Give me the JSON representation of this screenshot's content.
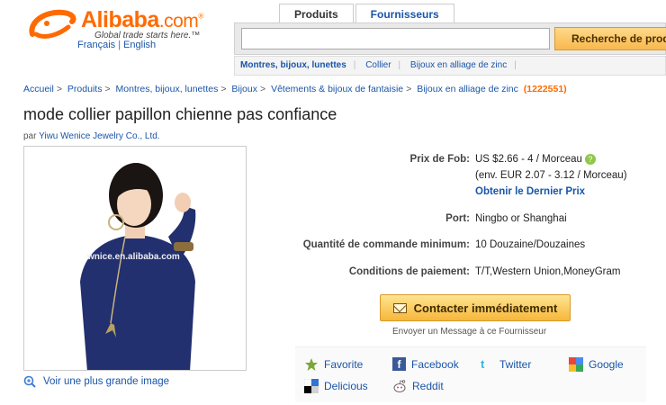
{
  "header": {
    "logo_name": "Alibaba",
    "logo_tld": ".com",
    "logo_reg": "®",
    "tagline": "Global trade starts here.™",
    "lang_fr": "Français",
    "lang_sep": "|",
    "lang_en": "English"
  },
  "search": {
    "tabs": [
      "Produits",
      "Fournisseurs"
    ],
    "active_tab": "Produits",
    "input_value": "",
    "button_label": "Recherche de prod",
    "categories": [
      "Montres, bijoux, lunettes",
      "Collier",
      "Bijoux en alliage de zinc"
    ]
  },
  "breadcrumb": {
    "items": [
      "Accueil",
      "Produits",
      "Montres, bijoux, lunettes",
      "Bijoux",
      "Vêtements & bijoux de fantaisie",
      "Bijoux en alliage de zinc"
    ],
    "separator": ">",
    "count": "(1222551)"
  },
  "product": {
    "title": "mode collier papillon chienne pas confiance",
    "seller_prefix": "par",
    "seller_name": "Yiwu Wenice Jewelry Co., Ltd.",
    "watermark": "wnice.en.alibaba.com",
    "enlarge_label": "Voir une plus grande image"
  },
  "specs": {
    "fob_label": "Prix de Fob:",
    "fob_value": "US $2.66 - 4 / Morceau",
    "fob_eur": "(env. EUR 2.07 - 3.12 / Morceau)",
    "fob_link": "Obtenir le Dernier Prix",
    "port_label": "Port:",
    "port_value": "Ningbo or Shanghai",
    "moq_label": "Quantité de commande minimum:",
    "moq_value": "10 Douzaine/Douzaines",
    "pay_label": "Conditions de paiement:",
    "pay_value": "T/T,Western Union,MoneyGram"
  },
  "contact": {
    "button_label": "Contacter immédiatement",
    "sub_label": "Envoyer un Message à ce Fournisseur"
  },
  "share": {
    "favorite": "Favorite",
    "facebook": "Facebook",
    "twitter": "Twitter",
    "google": "Google",
    "delicious": "Delicious",
    "reddit": "Reddit"
  },
  "colors": {
    "brand_orange": "#ff6a00",
    "link_blue": "#1a55a8",
    "button_gold": "#f6b73c"
  }
}
